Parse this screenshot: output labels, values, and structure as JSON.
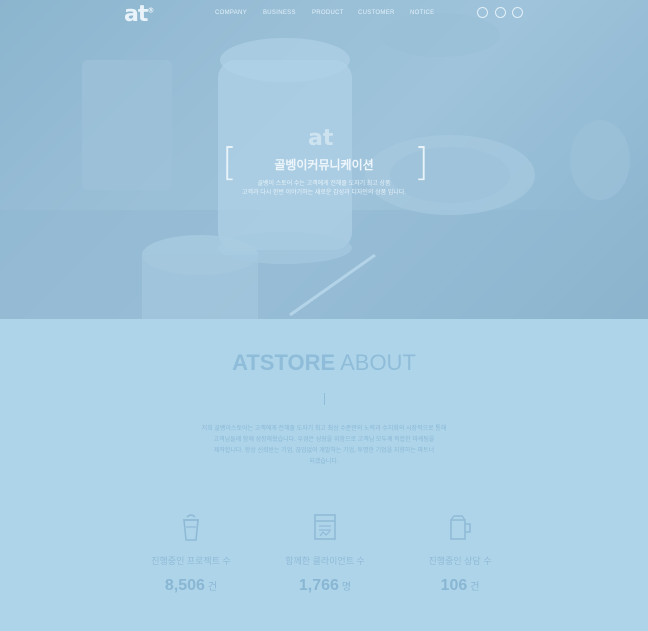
{
  "nav": {
    "logo": "at",
    "logo_mark": "®",
    "menu": [
      "COMPANY",
      "BUSINESS",
      "PRODUCT",
      "CUSTOMER",
      "NOTICE"
    ],
    "utility_icons": [
      "user-icon",
      "globe-icon",
      "menu-icon"
    ]
  },
  "hero": {
    "watermark": "at",
    "bracket_left": "[",
    "bracket_right": "]",
    "title": "골벵이커뮤니케이션",
    "sub1": "골벵이 스토어 수는 고객에게 전해줄 도자기 최고 상품",
    "sub2": "고객과 다시 한번 이야기하는 새로운 감성과 디자인의 상품 입니다."
  },
  "about": {
    "title_bold": "ATSTORE",
    "title_rest": "ABOUT",
    "lines": [
      "저희 골벵이스토어는 고객에게 전해줄 도자기 최고 최상 수준만의 노력과 수치화의 시장적으로 통해",
      "고객님들께 함께 성장해왔습니다. 우경은 성장을 위함으로 고객님 모두께 적합한 마케팅을",
      "제작합니다. 항상 신뢰받는 기업, 끊임없이 개발하는 기업, 투명한 기업을 지향하는 파트너",
      "되겠습니다."
    ]
  },
  "stats": [
    {
      "icon": "cup-icon",
      "label": "진행중인 프로젝트 수",
      "value": "8,506",
      "unit": "건"
    },
    {
      "icon": "document-icon",
      "label": "함께한 클라이언트 수",
      "value": "1,766",
      "unit": "명"
    },
    {
      "icon": "jug-icon",
      "label": "진행중인 상담 수",
      "value": "106",
      "unit": "건"
    }
  ],
  "colors": {
    "page_bg": "#aed4ea",
    "accent_text": "#8fbcd8"
  }
}
